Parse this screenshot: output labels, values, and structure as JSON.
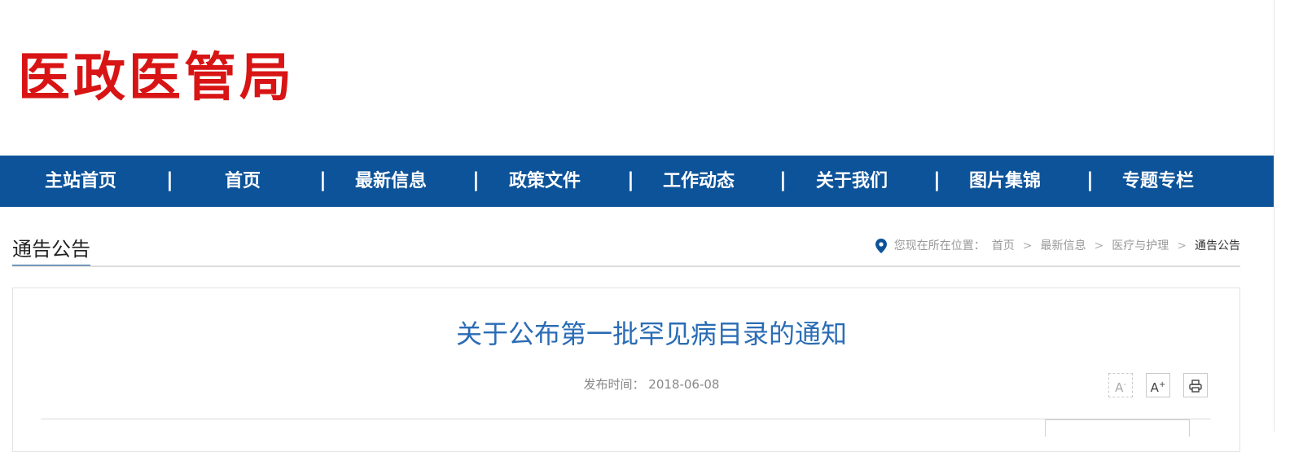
{
  "header": {
    "logo_text": "医政医管局"
  },
  "nav": {
    "items": [
      "主站首页",
      "首页",
      "最新信息",
      "政策文件",
      "工作动态",
      "关于我们",
      "图片集锦",
      "专题专栏"
    ],
    "separator": "|"
  },
  "section": {
    "title": "通告公告"
  },
  "breadcrumb": {
    "prefix": "您现在所在位置：",
    "items": [
      "首页",
      "最新信息",
      "医疗与护理",
      "通告公告"
    ],
    "separator": ">"
  },
  "article": {
    "title": "关于公布第一批罕见病目录的通知",
    "publish_label": "发布时间：",
    "publish_date": "2018-06-08"
  },
  "tools": {
    "font_smaller_label": "A",
    "font_smaller_mark": "-",
    "font_larger_label": "A",
    "font_larger_mark": "+"
  },
  "colors": {
    "brand_red": "#d81414",
    "nav_blue": "#0d5399",
    "title_blue": "#2a6cb5"
  },
  "icons": [
    "location-pin-icon",
    "print-icon"
  ]
}
